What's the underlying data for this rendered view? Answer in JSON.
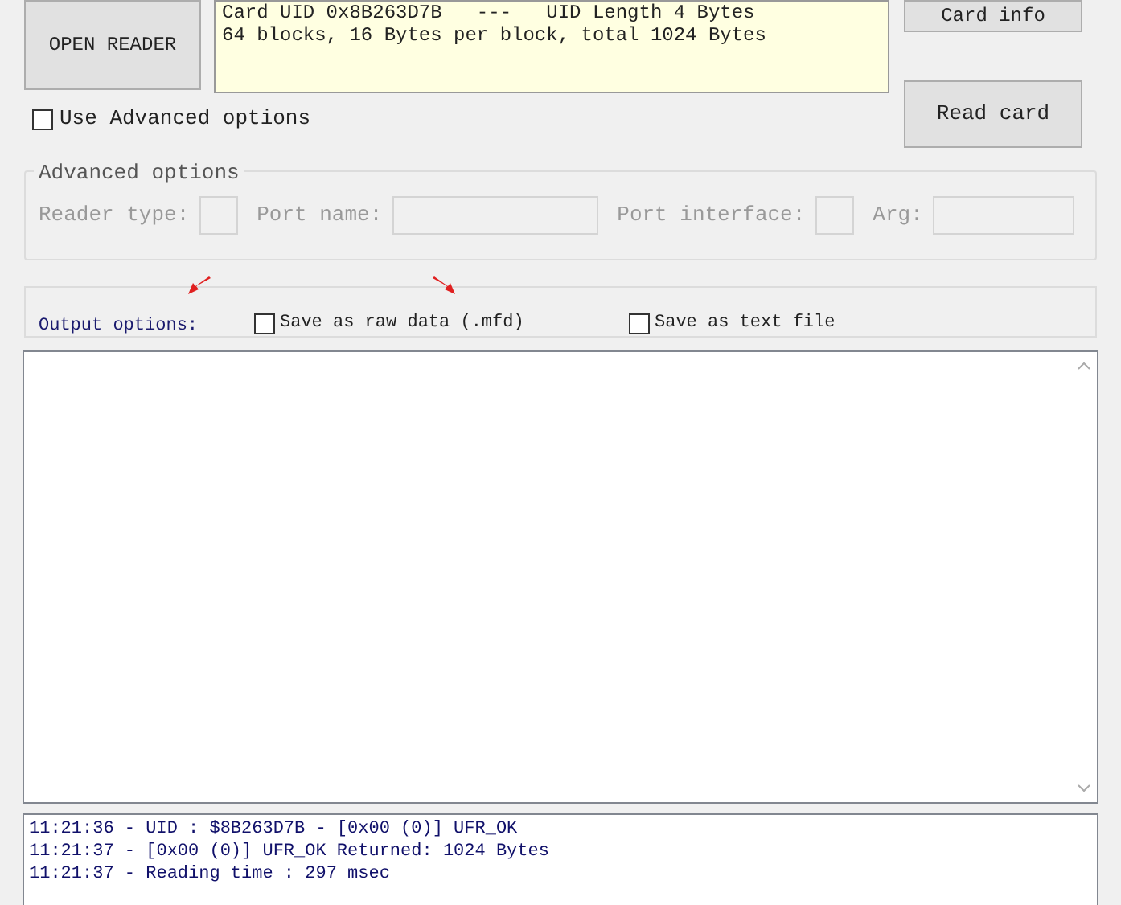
{
  "open_reader_button": "OPEN READER",
  "card_info_lines": [
    "Card UID 0x8B263D7B   ---   UID Length 4 Bytes",
    "64 blocks, 16 Bytes per block, total 1024 Bytes"
  ],
  "card_info_button": "Card info",
  "read_card_button": "Read card",
  "use_advanced": {
    "label": "Use Advanced options",
    "checked": false
  },
  "advanced_options": {
    "title": "Advanced options",
    "disabled": true,
    "fields": [
      {
        "label": "Reader type:"
      },
      {
        "label": "Port name:"
      },
      {
        "label": "Port interface:"
      },
      {
        "label": "Arg:"
      }
    ]
  },
  "output_options": {
    "label": "Output options:",
    "checkboxes": [
      {
        "label": "Save as raw data (.mfd)",
        "checked": false
      },
      {
        "label": "Save as text file",
        "checked": false
      }
    ]
  },
  "log_lines": [
    "11:21:36 - UID : $8B263D7B - [0x00 (0)] UFR_OK",
    "11:21:37 - [0x00 (0)] UFR_OK Returned: 1024 Bytes",
    "11:21:37 - Reading time : 297 msec"
  ]
}
